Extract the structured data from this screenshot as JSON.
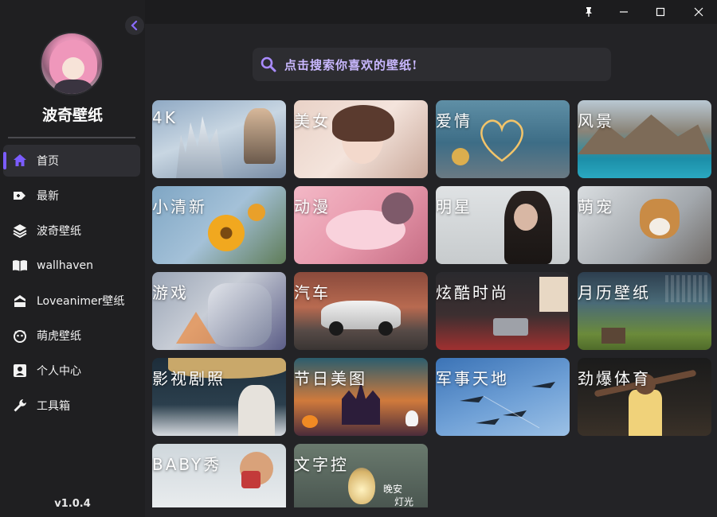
{
  "app": {
    "name": "波奇壁纸",
    "version": "v1.0.4"
  },
  "nav": {
    "items": [
      {
        "label": "首页",
        "icon": "home-icon",
        "active": true
      },
      {
        "label": "最新",
        "icon": "new-tag-icon"
      },
      {
        "label": "波奇壁纸",
        "icon": "layers-icon"
      },
      {
        "label": "wallhaven",
        "icon": "book-icon"
      },
      {
        "label": "Loveanimer壁纸",
        "icon": "stack-icon"
      },
      {
        "label": "萌虎壁纸",
        "icon": "tiger-icon"
      },
      {
        "label": "个人中心",
        "icon": "user-icon"
      },
      {
        "label": "工具箱",
        "icon": "wrench-icon"
      }
    ]
  },
  "search": {
    "placeholder": "点击搜索你喜欢的壁纸!"
  },
  "categories": [
    {
      "label": "4K"
    },
    {
      "label": "美女"
    },
    {
      "label": "爱情"
    },
    {
      "label": "风景"
    },
    {
      "label": "小清新"
    },
    {
      "label": "动漫"
    },
    {
      "label": "明星"
    },
    {
      "label": "萌宠"
    },
    {
      "label": "游戏"
    },
    {
      "label": "汽车"
    },
    {
      "label": "炫酷时尚"
    },
    {
      "label": "月历壁纸"
    },
    {
      "label": "影视剧照"
    },
    {
      "label": "节日美图"
    },
    {
      "label": "军事天地"
    },
    {
      "label": "劲爆体育"
    },
    {
      "label": "BABY秀"
    },
    {
      "label": "文字控"
    }
  ],
  "card_overlays": {
    "lamp_text_1": "晚安",
    "lamp_text_2": "灯光"
  },
  "colors": {
    "accent": "#7b5cff",
    "sidebar_bg": "#1f1f21",
    "main_bg": "#232326"
  }
}
